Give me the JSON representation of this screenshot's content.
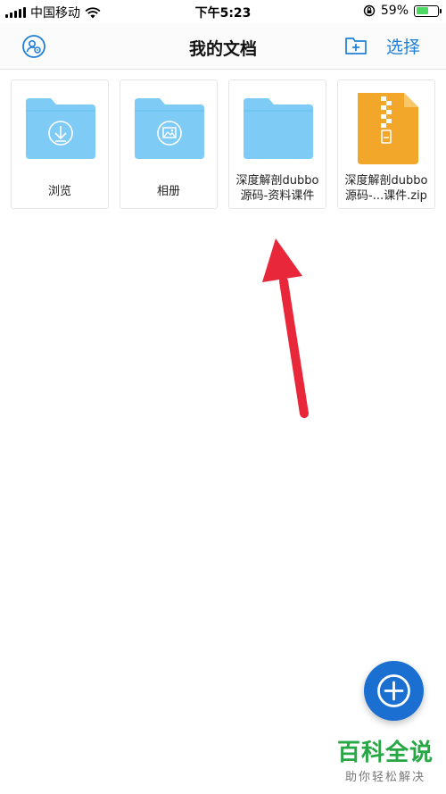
{
  "status_bar": {
    "carrier": "中国移动",
    "time": "下午5:23",
    "battery_percent": "59%",
    "battery_level": 0.59,
    "icons": [
      "signal-icon",
      "wifi-icon",
      "rotation-lock-icon",
      "battery-icon"
    ]
  },
  "nav": {
    "title": "我的文档",
    "select_label": "选择",
    "left_icon": "profile-settings-icon",
    "right_icon": "new-folder-icon"
  },
  "files": [
    {
      "name": "浏览",
      "icon": "download-folder-icon"
    },
    {
      "name": "相册",
      "icon": "photo-folder-icon"
    },
    {
      "name": "深度解剖dubbo源码-资料课件",
      "icon": "folder-icon"
    },
    {
      "name": "深度解剖dubbo源码-...课件.zip",
      "icon": "zip-file-icon"
    }
  ],
  "fab": {
    "icon": "plus-icon"
  },
  "watermark": {
    "title": "百科全说",
    "subtitle": "助你轻松解决"
  },
  "colors": {
    "accent": "#1f7fd8",
    "folder": "#7ecbf5",
    "zip": "#f3a72a",
    "fab": "#1a6fd0",
    "arrow": "#e8283a",
    "watermark": "#28a745"
  }
}
